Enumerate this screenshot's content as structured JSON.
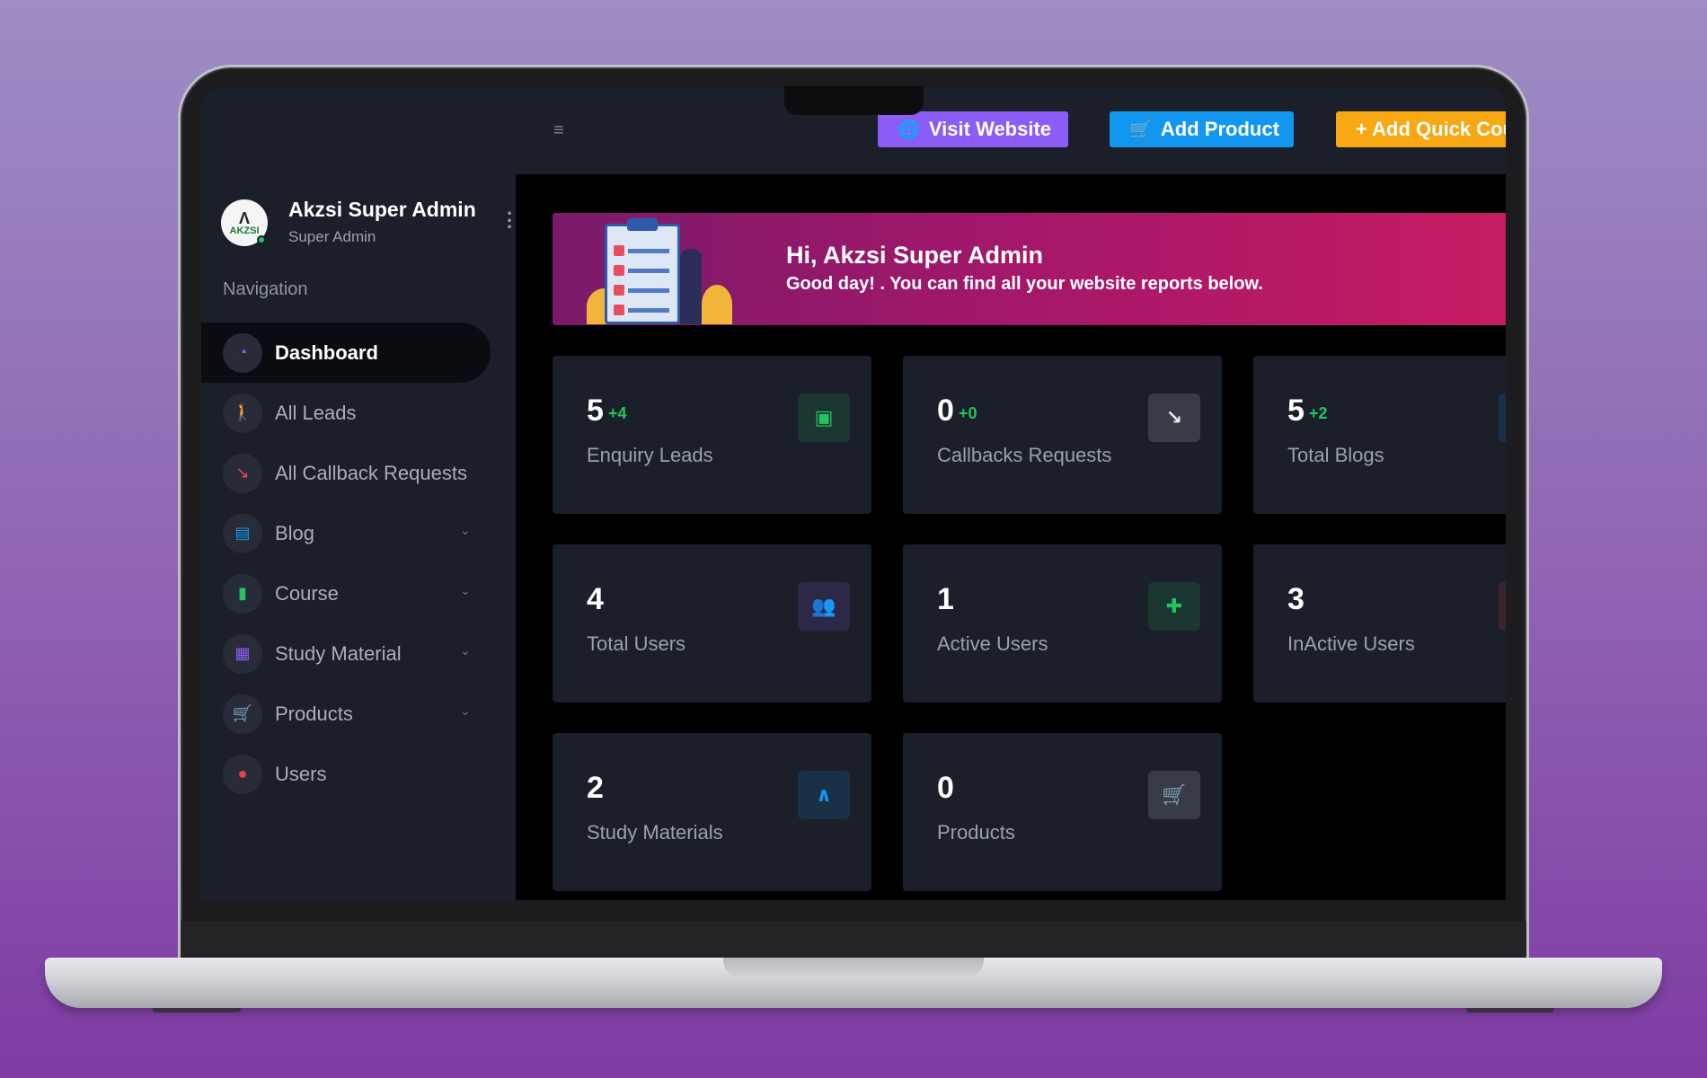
{
  "topbar": {
    "menu_icon": "hamburger-icon",
    "visit_label": "Visit Website",
    "visit_icon": "globe-icon",
    "add_product_label": "Add Product",
    "add_product_icon": "cart-icon",
    "quick_label": "+ Add Quick Cou"
  },
  "profile": {
    "name": "Akzsi Super Admin",
    "role": "Super Admin",
    "avatar_text": "AKZSI"
  },
  "sidebar": {
    "heading": "Navigation",
    "items": [
      {
        "label": "Dashboard",
        "icon": "gauge-icon",
        "color": "#8b5cf6",
        "expandable": false,
        "active": true
      },
      {
        "label": "All Leads",
        "icon": "person-icon",
        "color": "#f59e0b",
        "expandable": false,
        "active": false
      },
      {
        "label": "All Callback Requests",
        "icon": "trend-icon",
        "color": "#ef4444",
        "expandable": false,
        "active": false
      },
      {
        "label": "Blog",
        "icon": "layout-icon",
        "color": "#1296f0",
        "expandable": true,
        "active": false
      },
      {
        "label": "Course",
        "icon": "book-icon",
        "color": "#22c55e",
        "expandable": true,
        "active": false
      },
      {
        "label": "Study Material",
        "icon": "notes-icon",
        "color": "#8b5cf6",
        "expandable": true,
        "active": false
      },
      {
        "label": "Products",
        "icon": "cart-icon",
        "color": "#f59e0b",
        "expandable": true,
        "active": false
      },
      {
        "label": "Users",
        "icon": "user-icon",
        "color": "#ef4444",
        "expandable": false,
        "active": false
      }
    ]
  },
  "banner": {
    "title": "Hi, Akzsi Super Admin",
    "subtitle": "Good day! . You can find all your website reports below."
  },
  "stats": [
    {
      "value": "5",
      "delta": "+4",
      "label": "Enquiry Leads",
      "icon": "id-card-icon",
      "color": "#22c55e"
    },
    {
      "value": "0",
      "delta": "+0",
      "label": "Callbacks Requests",
      "icon": "trend-icon",
      "color": "#e5e7eb"
    },
    {
      "value": "5",
      "delta": "+2",
      "label": "Total Blogs",
      "icon": "blog-icon",
      "color": "#1296f0"
    },
    {
      "value": "4",
      "delta": "",
      "label": "Total Users",
      "icon": "users-icon",
      "color": "#8b5cf6"
    },
    {
      "value": "1",
      "delta": "",
      "label": "Active Users",
      "icon": "user-plus-icon",
      "color": "#22c55e"
    },
    {
      "value": "3",
      "delta": "",
      "label": "InActive Users",
      "icon": "user-minus-icon",
      "color": "#ef4444"
    },
    {
      "value": "2",
      "delta": "",
      "label": "Study Materials",
      "icon": "compass-icon",
      "color": "#1296f0"
    },
    {
      "value": "0",
      "delta": "",
      "label": "Products",
      "icon": "cart-icon",
      "color": "#e5e7eb"
    }
  ]
}
